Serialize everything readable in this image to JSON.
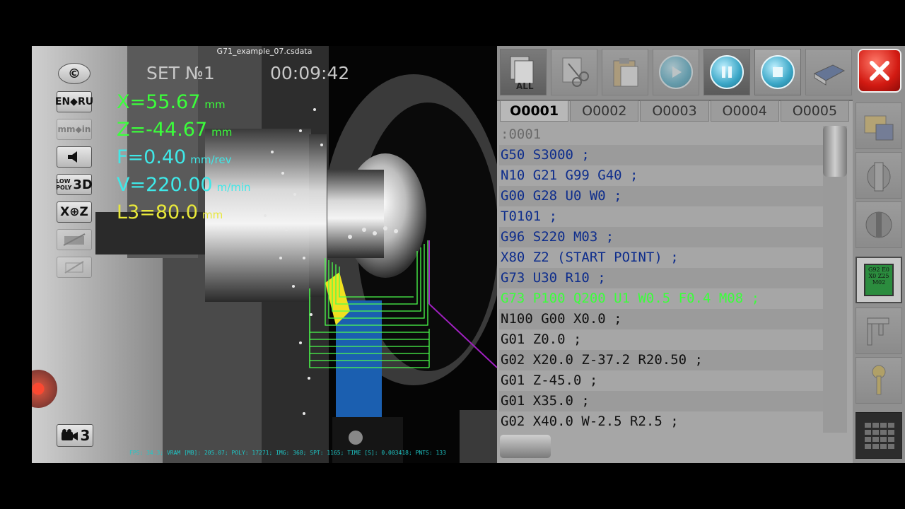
{
  "scene": {
    "file_title": "G71_example_07.csdata",
    "set_label": "SET №1",
    "timer": "00:09:42",
    "readouts": [
      {
        "text": "X=55.67",
        "unit": "mm",
        "color": "#3bff3b"
      },
      {
        "text": "Z=-44.67",
        "unit": "mm",
        "color": "#3bff3b"
      },
      {
        "text": "F=0.40",
        "unit": "mm/rev",
        "color": "#3fe8e8"
      },
      {
        "text": "V=220.00",
        "unit": "m/min",
        "color": "#3fe8e8"
      },
      {
        "text": "L3=80.0",
        "unit": "mm",
        "color": "#e8e83a"
      }
    ],
    "left_buttons": {
      "copyright": "©",
      "lang": "EN◆RU",
      "units": "mm◆in",
      "lowpoly_top": "LOW",
      "lowpoly_bottom": "POLY",
      "lowpoly_3d": "3D",
      "xz": "X⊕Z"
    },
    "camera": {
      "number": "3"
    },
    "stats": "FPS: 34.3; VRAM [MB]: 205.07; POLY: 17271; IMG: 368; SPT: 1165; TIME [S]: 0.003418; PNTS: 133"
  },
  "panel": {
    "toolbar": {
      "all_label": "ALL"
    },
    "tabs": [
      "O0001",
      "O0002",
      "O0003",
      "O0004",
      "O0005"
    ],
    "active_tab": 0,
    "code_lines": [
      {
        "text": ":0001",
        "state": "dim"
      },
      {
        "text": "G50 S3000 ;",
        "state": "normal"
      },
      {
        "text": "N10 G21 G99 G40 ;",
        "state": "normal"
      },
      {
        "text": "G00 G28 U0 W0 ;",
        "state": "normal"
      },
      {
        "text": "T0101 ;",
        "state": "normal"
      },
      {
        "text": "G96 S220 M03 ;",
        "state": "normal"
      },
      {
        "text": "X80 Z2 (START POINT) ;",
        "state": "normal"
      },
      {
        "text": "G73 U30 R10 ;",
        "state": "normal"
      },
      {
        "text": "G73 P100 Q200 U1 W0.5 F0.4 M08 ;",
        "state": "hl"
      },
      {
        "text": "N100 G00 X0.0 ;",
        "state": "dark"
      },
      {
        "text": "G01 Z0.0 ;",
        "state": "dark"
      },
      {
        "text": "G02 X20.0 Z-37.2 R20.50 ;",
        "state": "dark"
      },
      {
        "text": "G01 Z-45.0 ;",
        "state": "dark"
      },
      {
        "text": "G01 X35.0 ;",
        "state": "dark"
      },
      {
        "text": "G02 X40.0 W-2.5 R2.5 ;",
        "state": "dark"
      }
    ],
    "gcode_card": [
      "G92 E0",
      "X0 Z25",
      "M02"
    ],
    "colors": {
      "code_text": "#0e2d8c",
      "code_dark": "#111111",
      "highlight": "#3bff3b"
    }
  }
}
